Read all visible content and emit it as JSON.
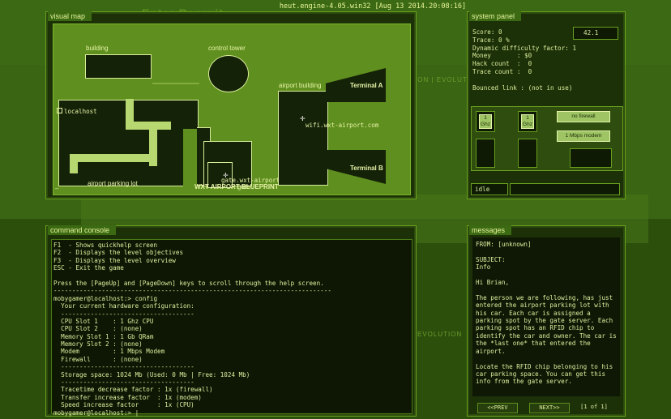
{
  "window": {
    "title": "heut.engine-4.05.win32 [Aug 13 2014.20:08:16]"
  },
  "background": {
    "logo_text": "Enter Recruit",
    "watermark_1": "ION | EVOLUTION",
    "watermark_2": "EVOLUTION"
  },
  "visual_map": {
    "title": "visual map",
    "labels": {
      "building": "building",
      "control_tower": "control tower",
      "airport_building": "airport building",
      "terminal_a": "Terminal A",
      "terminal_b": "Terminal B",
      "localhost": "localhost",
      "wifi": "wifi.wxt-airport.com",
      "gate_host": "gate.wxt-airport.com",
      "gate": "gate",
      "parking": "airport parking lot",
      "blueprint": "WXT AIRPORT BLUEPRINT",
      "minimize": "–"
    }
  },
  "system_panel": {
    "title": "system panel",
    "score_label": "Score: 0",
    "score_value": "42.1",
    "trace": "Trace: 0 %",
    "difficulty": "Dynamic difficulty factor: 1",
    "money": "Money       : $0",
    "hack_count": "Hack count  :  0",
    "trace_count": "Trace count :  0",
    "bounced_link": "Bounced link : (not in use)",
    "cpu_label": "1 Ghz",
    "cpu_label_2": "1 Ghz",
    "firewall_label": "no firewall",
    "modem_label": "1 Mbps modem",
    "status": "idle"
  },
  "command_console": {
    "title": "command console",
    "lines": [
      "F1  - Shows quickhelp screen",
      "F2  - Displays the level objectives",
      "F3  - Displays the level overview",
      "ESC - Exit the game",
      "",
      "Press the [PageUp] and [PageDown] keys to scroll through the help screen.",
      "---------------------------------------------------------------------------",
      "mobygamer@localhost:> config",
      "  Your current hardware configuration:",
      "  ------------------------------------",
      "  CPU Slot 1    : 1 Ghz CPU",
      "  CPU Slot 2    : (none)",
      "  Memory Slot 1 : 1 Gb QRam",
      "  Memory Slot 2 : (none)",
      "  Modem         : 1 Mbps Modem",
      "  Firewall      : (none)",
      "  ------------------------------------",
      "  Storage space: 1024 Mb (Used: 0 Mb | Free: 1024 Mb)",
      "  ------------------------------------",
      "  Tracetime decrease factor : 1x (firewall)",
      "  Transfer increase factor  : 1x (modem)",
      "  Speed increase factor     : 1x (CPU)",
      "mobygamer@localhost:> |"
    ]
  },
  "messages": {
    "title": "messages",
    "from": "FROM: [unknown]",
    "subject_label": "SUBJECT:",
    "subject": "Info",
    "greeting": "Hi Brian,",
    "body_1": "The person we are following, has just entered the airport parking lot with his car. Each car is assigned a parking spot by the gate server. Each parking spot has an RFID chip to identify the car and owner. The car is the *last one* that entered the airport.",
    "body_2": "Locate the RFID chip belonging to his car parking space. You can get this info from the gate server.",
    "prev": "<<PREV",
    "next": "NEXT>>",
    "page": "[1 of 1]"
  }
}
